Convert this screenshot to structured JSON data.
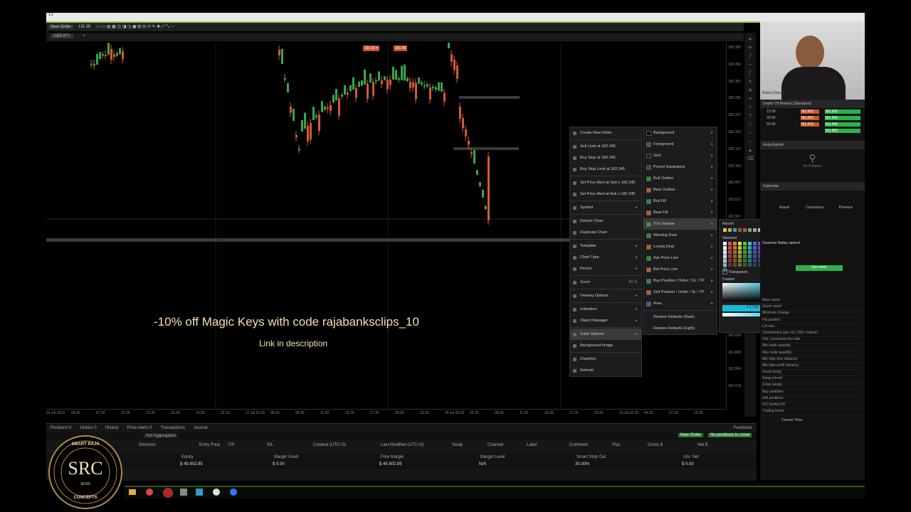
{
  "window_title": "13",
  "toolbar": {
    "new_order_label": "New Order",
    "timeframe_label": "US 30"
  },
  "chart_tab": {
    "symbol": "GBPJPY"
  },
  "chart": {
    "price_tag_left": "181.83 ▾",
    "price_tag_right": "181.85",
    "y_ticks": [
      "182.395",
      "182.350",
      "182.307",
      "182.281",
      "182.237",
      "182.192",
      "182.147",
      "182.102",
      "182.057",
      "182.012",
      "181.967",
      "181.923",
      "181.878",
      "181.833",
      "181.789",
      "181.744",
      "181.699",
      "181.654",
      "181.609",
      "181.564",
      "181.519"
    ],
    "x_ticks": [
      "14 Jul 2023",
      "04:30",
      "07:30",
      "10:30",
      "13:30",
      "16:30",
      "19:30",
      "22:30",
      "17 Jul 01:30",
      "05:30",
      "08:30",
      "11:30",
      "14:30",
      "17:30",
      "20:30",
      "23:30",
      "18 Jul 02:30",
      "05:30",
      "08:30",
      "11:30",
      "14:30",
      "17:30",
      "20:30",
      "19 Jul 01:30",
      "04:30",
      "07:30",
      "10:30"
    ]
  },
  "context_menu": {
    "items": [
      {
        "label": "Create New Order",
        "arrow": ""
      },
      {
        "label": "Sell Limit at 182.345",
        "arrow": ""
      },
      {
        "label": "Buy Stop at 182.345",
        "arrow": ""
      },
      {
        "label": "Buy Stop Limit at 182.345",
        "arrow": ""
      },
      {
        "label": "Set Price Alert at Sell ≥ 182.345",
        "arrow": ""
      },
      {
        "label": "Set Price Alert at Ask ≥ 182.345",
        "arrow": ""
      },
      {
        "label": "Symbol",
        "arrow": "▸"
      },
      {
        "label": "Detach Chart",
        "arrow": ""
      },
      {
        "label": "Duplicate Chart",
        "arrow": ""
      },
      {
        "label": "Template",
        "arrow": "▸"
      },
      {
        "label": "Chart Type",
        "arrow": "▸"
      },
      {
        "label": "Period",
        "arrow": "▸"
      },
      {
        "label": "Zoom",
        "arrow": "80 %"
      },
      {
        "label": "Viewing Options",
        "arrow": "▸"
      },
      {
        "label": "Indicators",
        "arrow": "▸"
      },
      {
        "label": "Object Manager",
        "arrow": "▸"
      },
      {
        "label": "Color Options",
        "arrow": "▸"
      },
      {
        "label": "Background Image",
        "arrow": ""
      },
      {
        "label": "Chatshot",
        "arrow": ""
      },
      {
        "label": "Refresh",
        "arrow": ""
      }
    ]
  },
  "color_submenu": {
    "items": [
      {
        "label": "Background",
        "color": "#000000"
      },
      {
        "label": "Foreground",
        "color": "#555555"
      },
      {
        "label": "Grid",
        "color": "#222222"
      },
      {
        "label": "Period Separators",
        "color": "#444444"
      },
      {
        "label": "Bull Outline",
        "color": "#2e8b3e"
      },
      {
        "label": "Bear Outline",
        "color": "#c7562e"
      },
      {
        "label": "Bull Fill",
        "color": "#2e8b3e"
      },
      {
        "label": "Bear Fill",
        "color": "#c7562e"
      },
      {
        "label": "Tick Volume",
        "color": "#3a9a4a"
      },
      {
        "label": "Winning Deal",
        "color": "#2e8b3e"
      },
      {
        "label": "Losing Deal",
        "color": "#c7562e"
      },
      {
        "label": "Ask Price Line",
        "color": "#2e8b3e"
      },
      {
        "label": "Bid Price Line",
        "color": "#c7562e"
      },
      {
        "label": "Buy Position / Order / SL / TP",
        "color": "#2e8b3e"
      },
      {
        "label": "Sell Position / Order / SL / TP",
        "color": "#c7562e"
      },
      {
        "label": "Area",
        "color": "#2e6b9b"
      },
      {
        "label": "Restore Defaults (Dark)",
        "color": ""
      },
      {
        "label": "Restore Defaults (Light)",
        "color": ""
      }
    ]
  },
  "color_picker": {
    "recent_label": "Recent",
    "standard_label": "Standard",
    "transparent_label": "Transparent",
    "custom_label": "Custom",
    "hex_value": "# 17161 B 3"
  },
  "promo": {
    "headline": "-10% off Magic Keys with code rajabanksclips_10",
    "subline": "Link in description"
  },
  "right_panel": {
    "presenter_name": "Rakiel Zidwor",
    "depth_title": "Depth Of Market (Standard)",
    "depth_rows": [
      {
        "vol": "15.00",
        "sell": "181.825",
        "buy": "181.835",
        "vol2": ""
      },
      {
        "vol": "30.00",
        "sell": "181.820",
        "buy": "181.840",
        "vol2": ""
      },
      {
        "vol": "50.00",
        "sell": "181.815",
        "buy": "181.845",
        "vol2": ""
      },
      {
        "vol": "",
        "sell": "",
        "buy": "181.850",
        "vol2": ""
      }
    ],
    "autochartist_title": "Autochartist",
    "no_patterns": "No Patterns",
    "calendar_title": "Calendar",
    "cal_actual": "Actual",
    "cal_consensus": "Consensus",
    "cal_previous": "Previous",
    "cal_event": "Governor Bailey speech",
    "see_more": "See more",
    "stats": [
      "Base asset",
      "Quote asset",
      "Minimum change",
      "Pip position",
      "Lot size",
      "Commission (per mil, USD volume)",
      "P&L conversion fee rate",
      "Min trade quantity",
      "Max trade quantity",
      "Min take-loss distance",
      "Min take profit distance",
      "Swap (long)",
      "Swap (short)",
      "3-day swaps",
      "Buy positions",
      "Sell positions",
      "FIX Symbol ID",
      "Trading hours"
    ],
    "current_time_label": "Current Time:"
  },
  "bottom_panel": {
    "tabs": [
      "Positions 0",
      "Orders 0",
      "History",
      "Price Alerts 0",
      "Transactions",
      "Journal"
    ],
    "feedback": "Feedback",
    "aggregation": "Not Aggregated",
    "new_order_btn": "New Order",
    "no_positions": "No positions to close",
    "columns": [
      "Direction",
      "Entry Price",
      "T/P",
      "S/L",
      "Created (UTC+3)",
      "Last Modified (UTC+3)",
      "Swap",
      "Channel",
      "Label",
      "Comment",
      "Pips",
      "Gross $",
      "Net $"
    ],
    "summary_labels": [
      "Equity",
      "Margin Used",
      "Free Margin",
      "Margin Level",
      "Smart Stop Out",
      "Unr. Net"
    ],
    "summary_values": [
      "$ 45 802.95",
      "$ 0.00",
      "$ 45 802.95",
      "N/A",
      "30.00%",
      "$ 0.00"
    ]
  },
  "logo": {
    "top": "SMART RAJA",
    "mid": "SRC",
    "bottom": "CONCEPTS",
    "sub": "SCSS"
  }
}
